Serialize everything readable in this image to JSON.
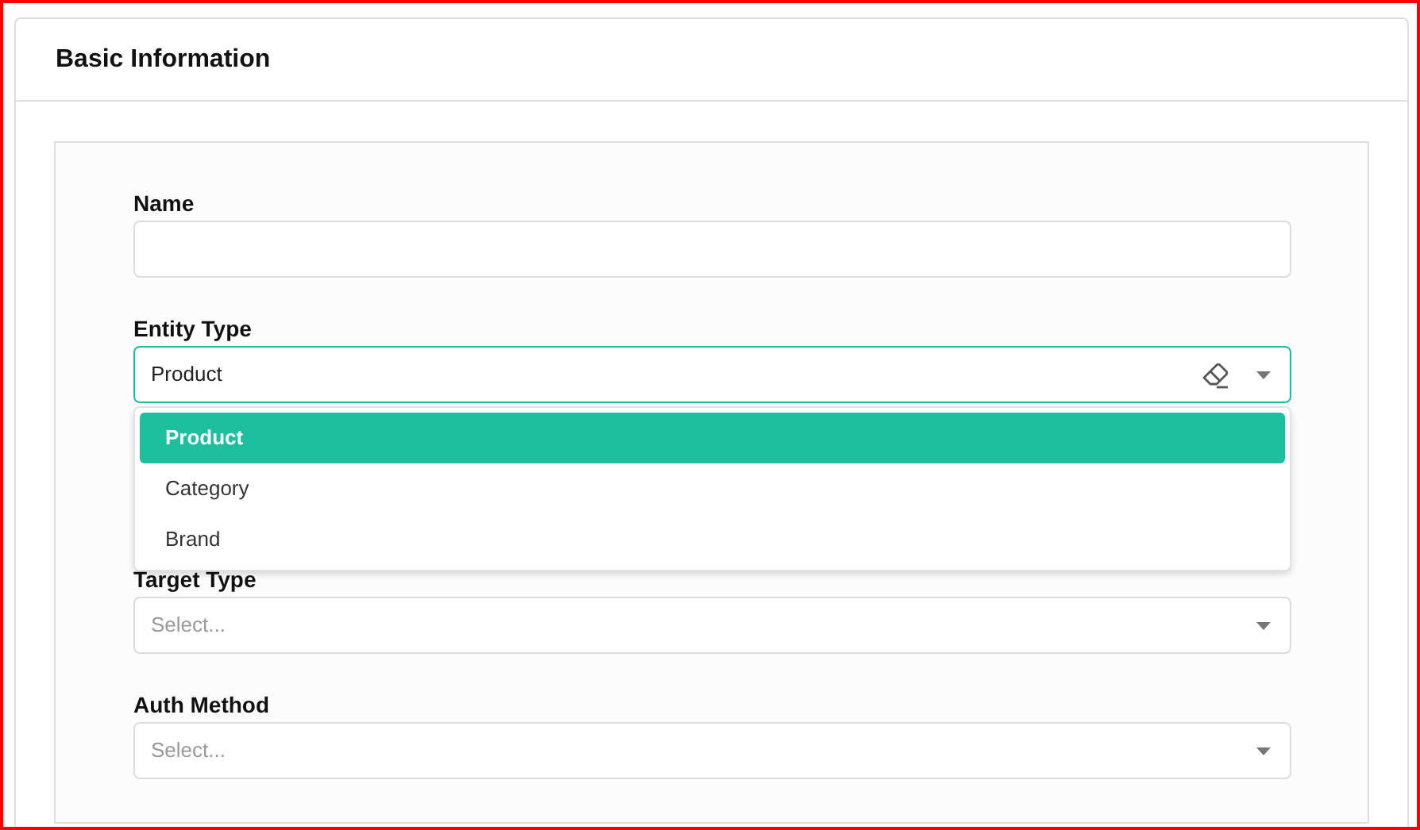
{
  "card": {
    "title": "Basic Information"
  },
  "fields": [
    {
      "label": "Name",
      "kind": "text"
    },
    {
      "label": "Entity Type",
      "kind": "select",
      "value": "Product",
      "focused": true,
      "clearable": true,
      "open": true,
      "options": [
        {
          "label": "Product",
          "selected": true
        },
        {
          "label": "Category",
          "selected": false
        },
        {
          "label": "Brand",
          "selected": false
        }
      ]
    },
    {
      "kind": "hidden"
    },
    {
      "label": "Target Type",
      "kind": "select",
      "placeholder": "Select...",
      "focused": false
    },
    {
      "label": "Auth Method",
      "kind": "select",
      "placeholder": "Select...",
      "focused": false
    }
  ]
}
